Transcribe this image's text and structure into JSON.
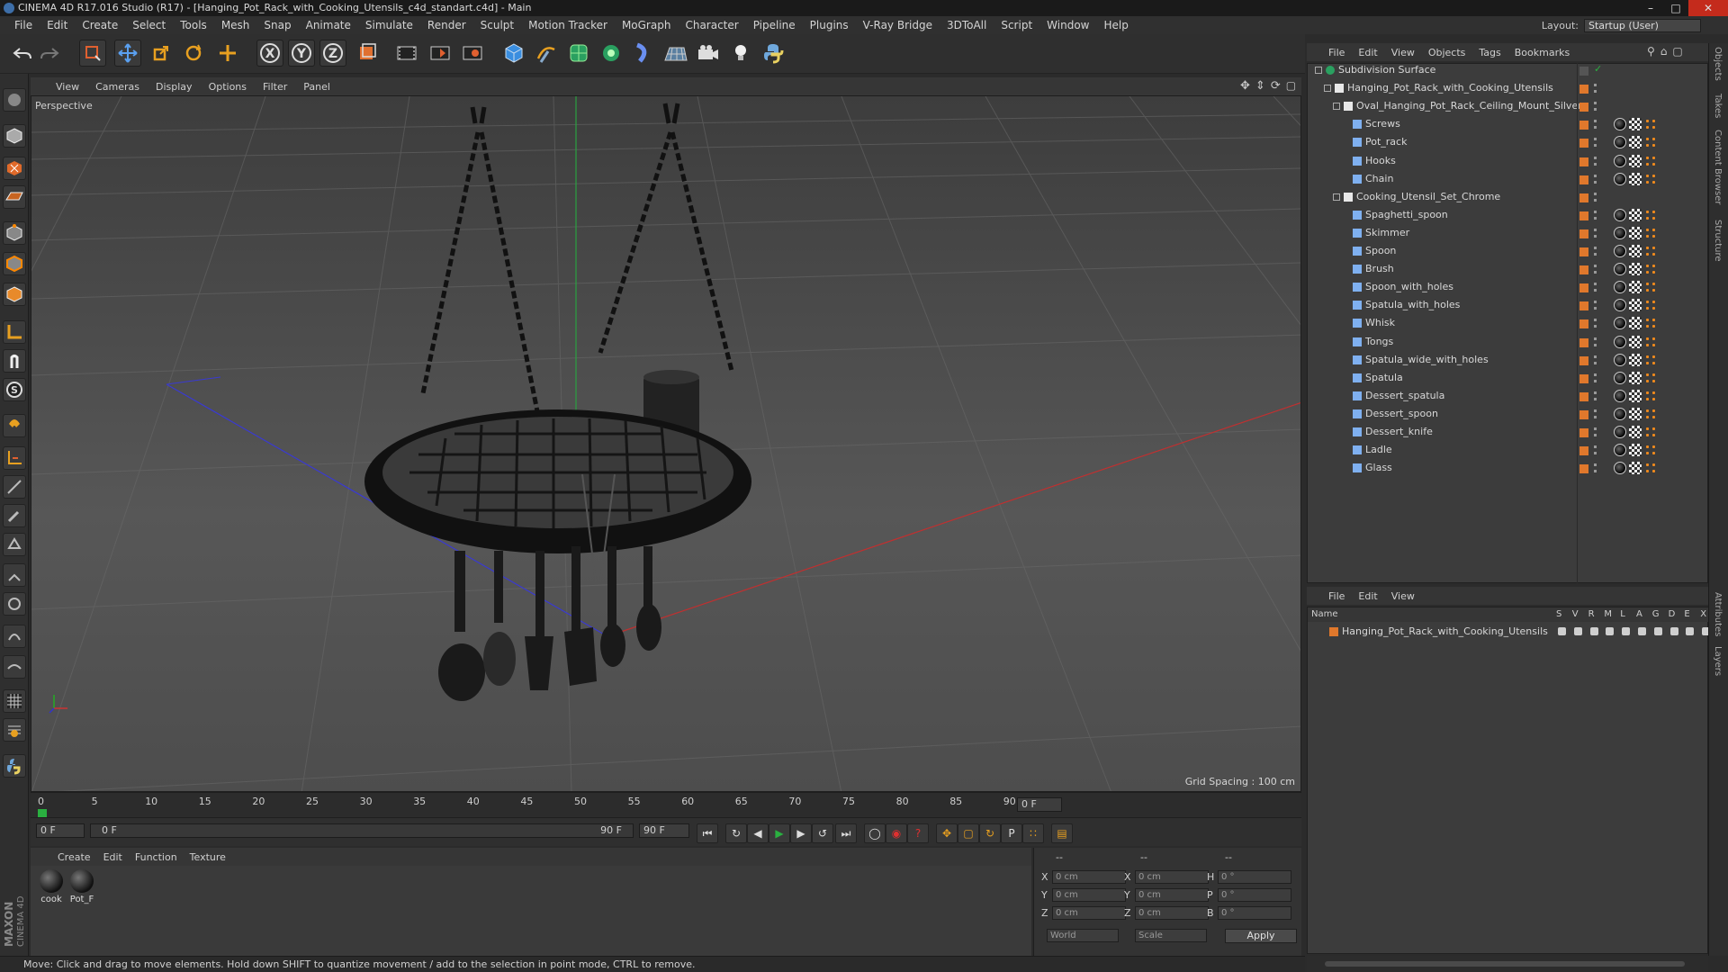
{
  "window": {
    "title": "CINEMA 4D R17.016 Studio (R17) - [Hanging_Pot_Rack_with_Cooking_Utensils_c4d_standart.c4d] - Main"
  },
  "menubar": [
    "File",
    "Edit",
    "Create",
    "Select",
    "Tools",
    "Mesh",
    "Snap",
    "Animate",
    "Simulate",
    "Render",
    "Sculpt",
    "Motion Tracker",
    "MoGraph",
    "Character",
    "Pipeline",
    "Plugins",
    "V-Ray Bridge",
    "3DToAll",
    "Script",
    "Window",
    "Help"
  ],
  "layout": {
    "label": "Layout:",
    "value": "Startup (User)"
  },
  "toolbar": {
    "axis_x": "X",
    "axis_y": "Y",
    "axis_z": "Z"
  },
  "lefttools": {
    "s_label": "S"
  },
  "viewport": {
    "menu": [
      "View",
      "Cameras",
      "Display",
      "Options",
      "Filter",
      "Panel"
    ],
    "camera_label": "Perspective",
    "grid_spacing": "Grid Spacing : 100 cm"
  },
  "timeline": {
    "ticks": [
      "0",
      "5",
      "10",
      "15",
      "20",
      "25",
      "30",
      "35",
      "40",
      "45",
      "50",
      "55",
      "60",
      "65",
      "70",
      "75",
      "80",
      "85",
      "90"
    ],
    "end_frame_field": "0 F"
  },
  "playbar": {
    "start_field": "0 F",
    "range_start": "0 F",
    "range_end": "90 F",
    "end_field": "90 F"
  },
  "material_manager": {
    "menu": [
      "Create",
      "Edit",
      "Function",
      "Texture"
    ],
    "materials": [
      {
        "name": "cook"
      },
      {
        "name": "Pot_F"
      }
    ]
  },
  "coordinates": {
    "headers": [
      "--",
      "--",
      "--"
    ],
    "rows": [
      {
        "l1": "X",
        "v1": "0 cm",
        "l2": "X",
        "v2": "0 cm",
        "l3": "H",
        "v3": "0 °"
      },
      {
        "l1": "Y",
        "v1": "0 cm",
        "l2": "Y",
        "v2": "0 cm",
        "l3": "P",
        "v3": "0 °"
      },
      {
        "l1": "Z",
        "v1": "0 cm",
        "l2": "Z",
        "v2": "0 cm",
        "l3": "B",
        "v3": "0 °"
      }
    ],
    "space": "World",
    "mode": "Scale",
    "apply": "Apply"
  },
  "status_text": "Move: Click and drag to move elements. Hold down SHIFT to quantize movement / add to the selection in point mode, CTRL to remove.",
  "object_manager": {
    "menu": [
      "File",
      "Edit",
      "View",
      "Objects",
      "Tags",
      "Bookmarks"
    ],
    "objects": [
      {
        "name": "Subdivision Surface",
        "depth": 0,
        "tags": false
      },
      {
        "name": "Hanging_Pot_Rack_with_Cooking_Utensils",
        "depth": 1,
        "tags": false
      },
      {
        "name": "Oval_Hanging_Pot_Rack_Ceiling_Mount_Silver",
        "depth": 2,
        "tags": false
      },
      {
        "name": "Screws",
        "depth": 3,
        "tags": true
      },
      {
        "name": "Pot_rack",
        "depth": 3,
        "tags": true
      },
      {
        "name": "Hooks",
        "depth": 3,
        "tags": true
      },
      {
        "name": "Chain",
        "depth": 3,
        "tags": true
      },
      {
        "name": "Cooking_Utensil_Set_Chrome",
        "depth": 2,
        "tags": false
      },
      {
        "name": "Spaghetti_spoon",
        "depth": 3,
        "tags": true
      },
      {
        "name": "Skimmer",
        "depth": 3,
        "tags": true
      },
      {
        "name": "Spoon",
        "depth": 3,
        "tags": true
      },
      {
        "name": "Brush",
        "depth": 3,
        "tags": true
      },
      {
        "name": "Spoon_with_holes",
        "depth": 3,
        "tags": true
      },
      {
        "name": "Spatula_with_holes",
        "depth": 3,
        "tags": true
      },
      {
        "name": "Whisk",
        "depth": 3,
        "tags": true
      },
      {
        "name": "Tongs",
        "depth": 3,
        "tags": true
      },
      {
        "name": "Spatula_wide_with_holes",
        "depth": 3,
        "tags": true
      },
      {
        "name": "Spatula",
        "depth": 3,
        "tags": true
      },
      {
        "name": "Dessert_spatula",
        "depth": 3,
        "tags": true
      },
      {
        "name": "Dessert_spoon",
        "depth": 3,
        "tags": true
      },
      {
        "name": "Dessert_knife",
        "depth": 3,
        "tags": true
      },
      {
        "name": "Ladle",
        "depth": 3,
        "tags": true
      },
      {
        "name": "Glass",
        "depth": 3,
        "tags": true
      }
    ]
  },
  "layer_manager": {
    "menu": [
      "File",
      "Edit",
      "View"
    ],
    "columns": [
      "Name",
      "S",
      "V",
      "R",
      "M",
      "L",
      "A",
      "G",
      "D",
      "E",
      "X"
    ],
    "layers": [
      {
        "name": "Hanging_Pot_Rack_with_Cooking_Utensils",
        "color": "#e0782c"
      }
    ]
  },
  "right_tabs": [
    "Objects",
    "Takes",
    "Content Browser",
    "Structure",
    "Attributes",
    "Layers"
  ],
  "colors": {
    "accent_orange": "#e0782c",
    "x_axis": "#c0392b",
    "y_axis": "#27ae60",
    "z_axis": "#2f4fd0"
  }
}
